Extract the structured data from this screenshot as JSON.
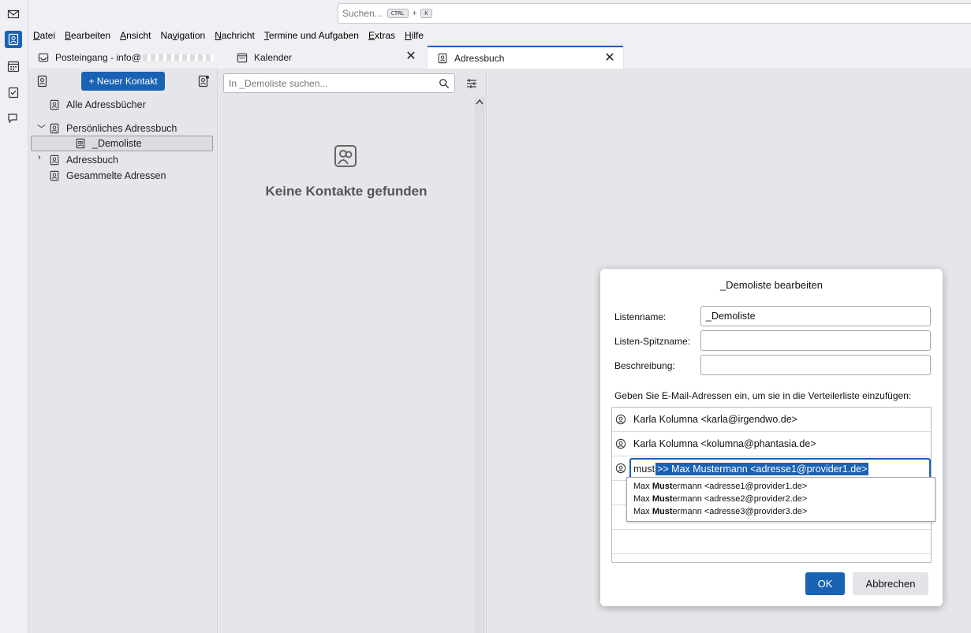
{
  "spaces": [
    "mail-icon",
    "addressbook-icon",
    "calendar-icon",
    "tasks-icon",
    "chat-icon"
  ],
  "search": {
    "placeholder": "Suchen...",
    "shortcut_ctrl": "CTRL",
    "shortcut_plus": "+",
    "shortcut_key": "K"
  },
  "menu": [
    {
      "underline": "D",
      "rest": "atei"
    },
    {
      "underline": "B",
      "rest": "earbeiten"
    },
    {
      "underline": "A",
      "rest": "nsicht"
    },
    {
      "pre": "Na",
      "underline": "v",
      "rest": "igation"
    },
    {
      "underline": "N",
      "rest": "achricht"
    },
    {
      "underline": "T",
      "rest": "ermine und Aufgaben"
    },
    {
      "underline": "E",
      "rest": "xtras"
    },
    {
      "underline": "H",
      "rest": "ilfe"
    }
  ],
  "tabs": {
    "inbox": "Posteingang - info@",
    "calendar": "Kalender",
    "addressbook": "Adressbuch",
    "close": "✕"
  },
  "books": {
    "new_contact": "+ Neuer Kontakt",
    "all": "Alle Adressbücher",
    "personal": "Persönliches Adressbuch",
    "demoliste": "_Demoliste",
    "adressbuch": "Adressbuch",
    "collected": "Gesammelte Adressen"
  },
  "cards": {
    "search_placeholder": "In _Demoliste suchen...",
    "empty": "Keine Kontakte gefunden"
  },
  "dialog": {
    "title": "_Demoliste bearbeiten",
    "listname_label": "Listenname:",
    "listname_value": "_Demoliste",
    "nickname_label": "Listen-Spitzname:",
    "nickname_value": "",
    "description_label": "Beschreibung:",
    "description_value": "",
    "instruction": "Geben Sie E-Mail-Adressen ein, um sie in die Verteilerliste einzufügen:",
    "members": [
      "Karla Kolumna <karla@irgendwo.de>",
      "Karla Kolumna <kolumna@phantasia.de>"
    ],
    "typed": "must",
    "completion": ">> Max Mustermann <adresse1@provider1.de>",
    "suggestions": [
      {
        "pre": "Max ",
        "bold": "Must",
        "post": "ermann <adresse1@provider1.de>"
      },
      {
        "pre": "Max ",
        "bold": "Must",
        "post": "ermann <adresse2@provider2.de>"
      },
      {
        "pre": "Max ",
        "bold": "Must",
        "post": "ermann <adresse3@provider3.de>"
      }
    ],
    "ok": "OK",
    "cancel": "Abbrechen"
  },
  "colors": {
    "accent": "#1a62b4",
    "panel": "#e6e6ea",
    "chrome": "#f0f0f4"
  }
}
